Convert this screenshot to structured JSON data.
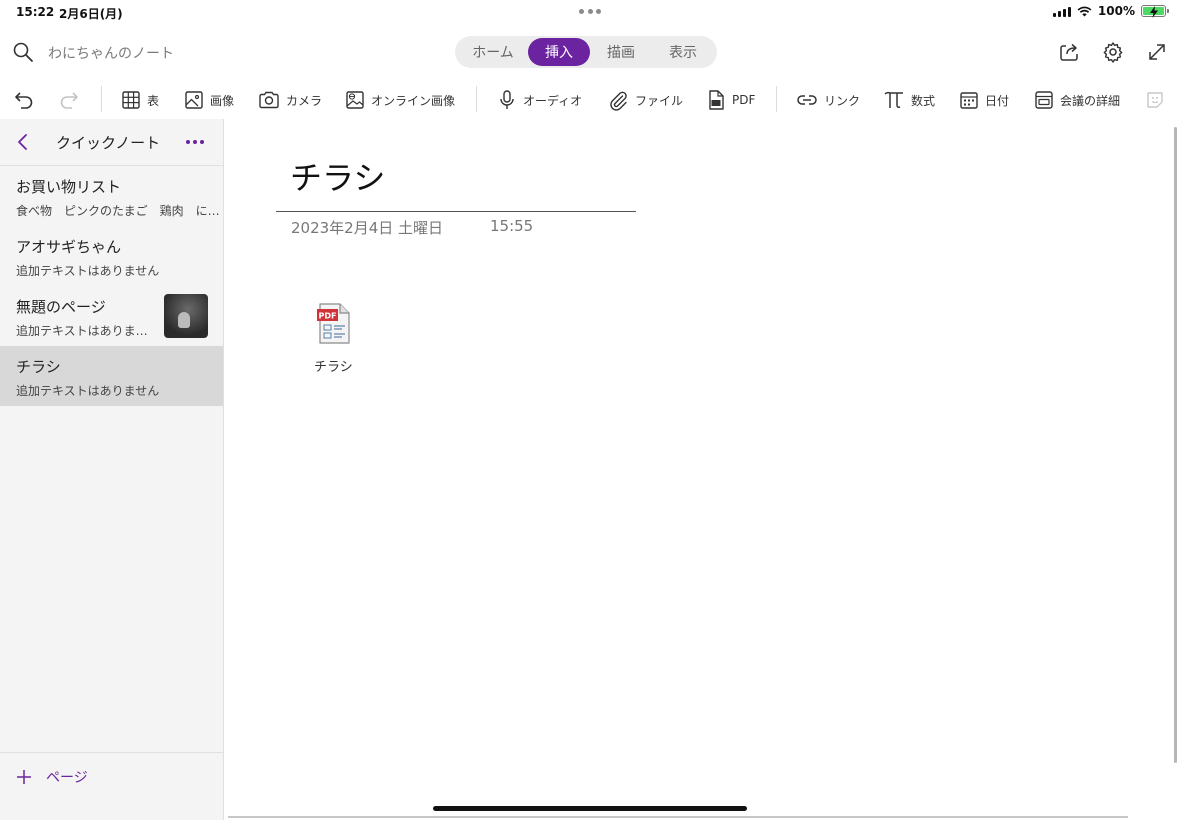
{
  "status": {
    "time": "15:22",
    "date": "2月6日(月)",
    "battery_pct": "100%"
  },
  "topbar": {
    "notebook_name": "わにちゃんのノート",
    "tabs": [
      {
        "label": "ホーム",
        "active": false
      },
      {
        "label": "挿入",
        "active": true
      },
      {
        "label": "描画",
        "active": false
      },
      {
        "label": "表示",
        "active": false
      }
    ],
    "accent_color": "#6b23a0"
  },
  "ribbon": {
    "table": "表",
    "image": "画像",
    "camera": "カメラ",
    "online_image": "オンライン画像",
    "audio": "オーディオ",
    "file": "ファイル",
    "pdf": "PDF",
    "link": "リンク",
    "math": "数式",
    "date": "日付",
    "meeting_details": "会議の詳細"
  },
  "sidebar": {
    "section_title": "クイックノート",
    "pages": [
      {
        "title": "お買い物リスト",
        "preview": "食べ物　ピンクのたまご　鶏肉　に…",
        "has_thumb": false,
        "selected": false
      },
      {
        "title": "アオサギちゃん",
        "preview": "追加テキストはありません",
        "has_thumb": false,
        "selected": false
      },
      {
        "title": "無題のページ",
        "preview": "追加テキストはありま…",
        "has_thumb": true,
        "selected": false
      },
      {
        "title": "チラシ",
        "preview": "追加テキストはありません",
        "has_thumb": false,
        "selected": true
      }
    ],
    "add_page_label": "ページ"
  },
  "page": {
    "title": "チラシ",
    "date": "2023年2月4日 土曜日",
    "time": "15:55",
    "attachment_label": "チラシ",
    "attachment_icon_text": "PDF"
  }
}
